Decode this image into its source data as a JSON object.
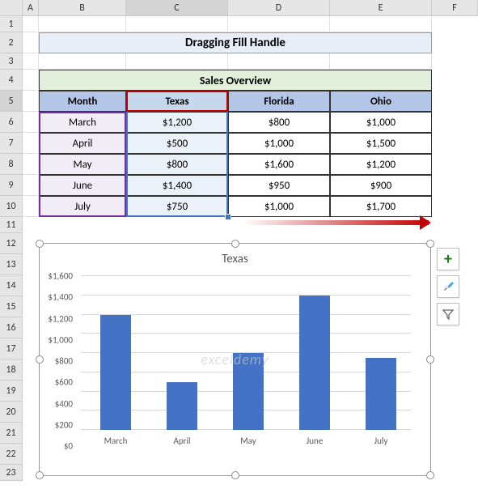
{
  "columns": [
    "A",
    "B",
    "C",
    "D",
    "E",
    "F"
  ],
  "rows": [
    "1",
    "2",
    "3",
    "4",
    "5",
    "6",
    "7",
    "8",
    "9",
    "10",
    "11",
    "12",
    "13",
    "14",
    "15",
    "16",
    "17",
    "18",
    "19",
    "20",
    "21",
    "22",
    "23"
  ],
  "title": "Dragging Fill Handle",
  "table": {
    "header": "Sales Overview",
    "cols": [
      "Month",
      "Texas",
      "Florida",
      "Ohio"
    ],
    "data": [
      {
        "month": "March",
        "texas": "$1,200",
        "florida": "$800",
        "ohio": "$1,000"
      },
      {
        "month": "April",
        "texas": "$500",
        "florida": "$1,000",
        "ohio": "$1,500"
      },
      {
        "month": "May",
        "texas": "$800",
        "florida": "$1,600",
        "ohio": "$1,200"
      },
      {
        "month": "June",
        "texas": "$1,400",
        "florida": "$950",
        "ohio": "$900"
      },
      {
        "month": "July",
        "texas": "$750",
        "florida": "$1,000",
        "ohio": "$1,700"
      }
    ]
  },
  "chart_data": {
    "type": "bar",
    "title": "Texas",
    "categories": [
      "March",
      "April",
      "May",
      "June",
      "July"
    ],
    "values": [
      1200,
      500,
      800,
      1400,
      750
    ],
    "ylabel": "",
    "xlabel": "",
    "ylim": [
      0,
      1600
    ],
    "y_ticks": [
      "$0",
      "$200",
      "$400",
      "$600",
      "$800",
      "$1,000",
      "$1,200",
      "$1,400",
      "$1,600"
    ],
    "color": "#4472c4"
  },
  "chart_buttons": {
    "plus": "+",
    "brush": "brush-icon",
    "filter": "filter-icon"
  },
  "watermark": "exceldemy"
}
